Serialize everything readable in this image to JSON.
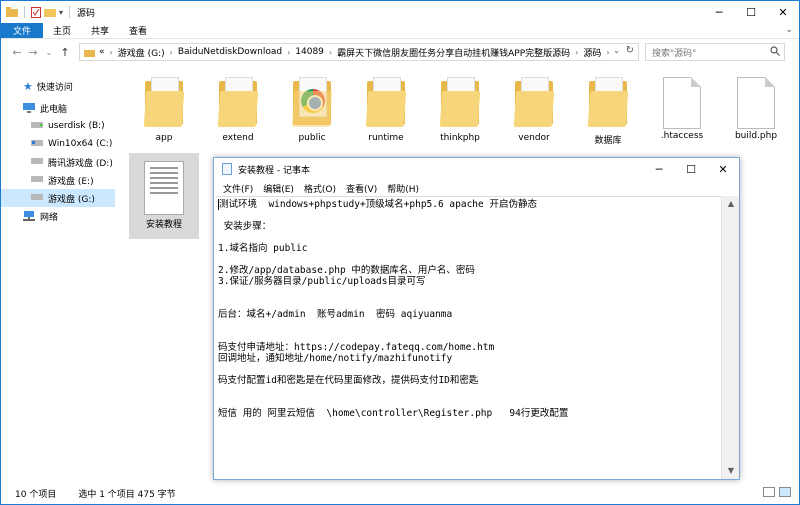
{
  "window": {
    "title": "源码",
    "controls": {
      "minimize": "─",
      "maximize": "☐",
      "close": "✕"
    }
  },
  "ribbon": {
    "tabs": [
      "文件",
      "主页",
      "共享",
      "查看"
    ],
    "expand_glyph": "⌄"
  },
  "nav": {
    "back": "←",
    "forward": "→",
    "recent": "⌄",
    "up": "↑",
    "breadcrumb": [
      "«",
      "游戏盘 (G:)",
      "BaiduNetdiskDownload",
      "14089",
      "霸屏天下微信朋友圈任务分享自动挂机赚钱APP完整版源码",
      "源码"
    ],
    "crumb_separator": "›",
    "refresh": "↻",
    "dropdown": "⌄"
  },
  "search": {
    "placeholder": "搜索\"源码\"",
    "icon": "search-icon"
  },
  "sidebar": {
    "items": [
      {
        "label": "快速访问",
        "icon": "star-icon"
      },
      {
        "label": "此电脑",
        "icon": "computer-icon"
      },
      {
        "label": "userdisk (B:)",
        "icon": "drive-icon"
      },
      {
        "label": "Win10x64 (C:)",
        "icon": "drive-icon"
      },
      {
        "label": "腾讯游戏盘 (D:)",
        "icon": "drive-icon"
      },
      {
        "label": "游戏盘 (E:)",
        "icon": "drive-icon"
      },
      {
        "label": "游戏盘 (G:)",
        "icon": "drive-icon"
      },
      {
        "label": "网络",
        "icon": "network-icon"
      }
    ]
  },
  "files": [
    {
      "name": "app",
      "kind": "folder"
    },
    {
      "name": "extend",
      "kind": "folder"
    },
    {
      "name": "public",
      "kind": "folder"
    },
    {
      "name": "runtime",
      "kind": "folder"
    },
    {
      "name": "thinkphp",
      "kind": "folder"
    },
    {
      "name": "vendor",
      "kind": "folder"
    },
    {
      "name": "数据库",
      "kind": "folder"
    },
    {
      "name": ".htaccess",
      "kind": "file"
    },
    {
      "name": "build.php",
      "kind": "file"
    },
    {
      "name": "安装教程",
      "kind": "text"
    }
  ],
  "statusbar": {
    "count": "10 个项目",
    "selection": "选中 1 个项目  475 字节"
  },
  "notepad": {
    "title": "安装教程 - 记事本",
    "controls": {
      "minimize": "─",
      "maximize": "☐",
      "close": "✕"
    },
    "scroll": {
      "up": "▲",
      "down": "▼"
    },
    "menu": [
      "文件(F)",
      "编辑(E)",
      "格式(O)",
      "查看(V)",
      "帮助(H)"
    ],
    "lines": [
      "测试环境  windows+phpstudy+顶级域名+php5.6 apache 开启伪静态",
      "",
      " 安装步骤：",
      "",
      "1.域名指向 public",
      "",
      "2.修改/app/database.php 中的数据库名、用户名、密码",
      "3.保证/服务器目录/public/uploads目录可写",
      "",
      "",
      "后台：域名+/admin  账号admin  密码 aqiyuanma",
      "",
      "",
      "码支付申请地址：https://codepay.fateqq.com/home.htm",
      "回调地址，通知地址/home/notify/mazhifunotify",
      "",
      "码支付配置id和密匙是在代码里面修改，提供码支付ID和密匙",
      "",
      "",
      "短信 用的 阿里云短信  \\home\\controller\\Register.php   94行更改配置"
    ]
  }
}
